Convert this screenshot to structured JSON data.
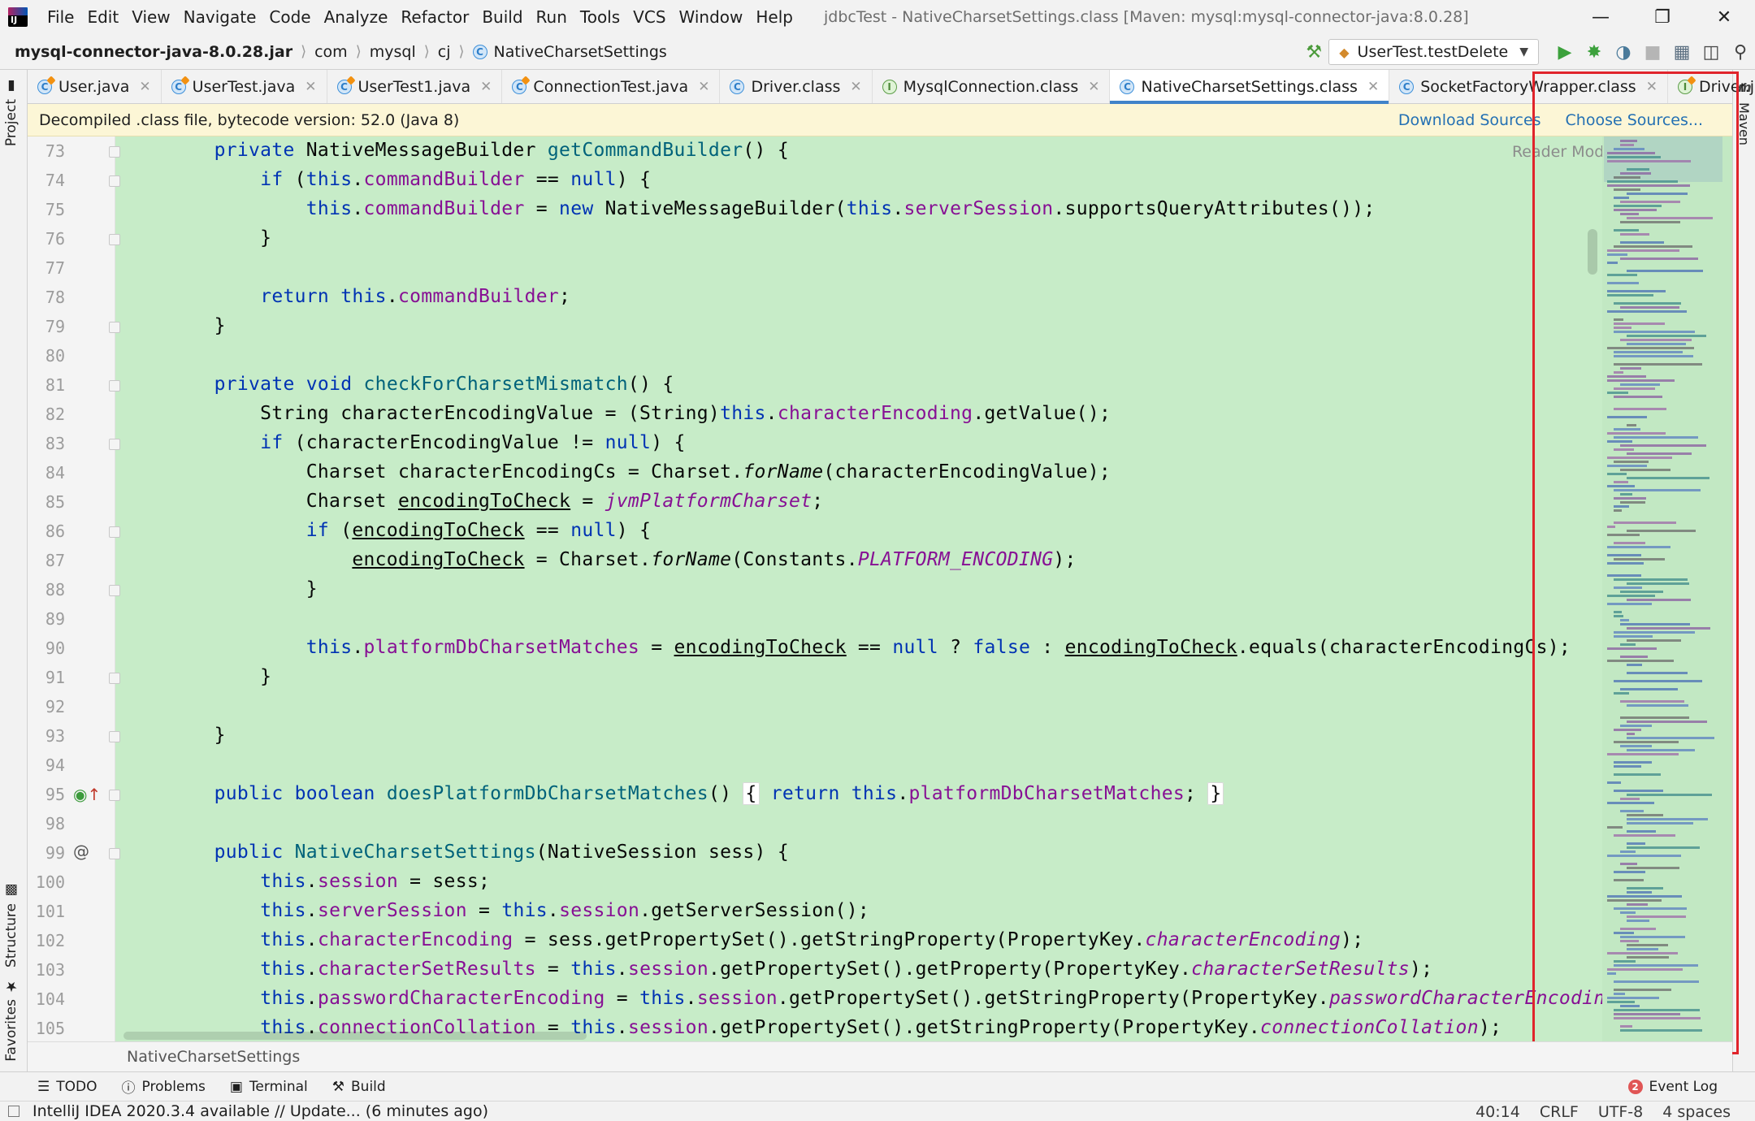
{
  "app": {
    "title": "jdbcTest - NativeCharsetSettings.class [Maven: mysql:mysql-connector-java:8.0.28]",
    "menu": [
      "File",
      "Edit",
      "View",
      "Navigate",
      "Code",
      "Analyze",
      "Refactor",
      "Build",
      "Run",
      "Tools",
      "VCS",
      "Window",
      "Help"
    ]
  },
  "nav": {
    "crumbs": [
      "mysql-connector-java-8.0.28.jar",
      "com",
      "mysql",
      "cj",
      "NativeCharsetSettings"
    ],
    "run_config": "UserTest.testDelete"
  },
  "tabs": [
    {
      "label": "User.java",
      "icon": "class-java"
    },
    {
      "label": "UserTest.java",
      "icon": "class-java"
    },
    {
      "label": "UserTest1.java",
      "icon": "class-java"
    },
    {
      "label": "ConnectionTest.java",
      "icon": "class-java"
    },
    {
      "label": "Driver.class",
      "icon": "class"
    },
    {
      "label": "MysqlConnection.class",
      "icon": "interface"
    },
    {
      "label": "NativeCharsetSettings.class",
      "icon": "class",
      "active": true
    },
    {
      "label": "SocketFactoryWrapper.class",
      "icon": "class"
    },
    {
      "label": "Driver.java",
      "icon": "interface-java"
    }
  ],
  "banner": {
    "text": "Decompiled .class file, bytecode version: 52.0 (Java 8)",
    "download": "Download Sources",
    "choose": "Choose Sources..."
  },
  "editor": {
    "reader_mode": "Reader Mode",
    "line_numbers": [
      "73",
      "74",
      "75",
      "76",
      "77",
      "78",
      "79",
      "80",
      "81",
      "82",
      "83",
      "84",
      "85",
      "86",
      "87",
      "88",
      "89",
      "90",
      "91",
      "92",
      "93",
      "94",
      "95",
      "98",
      "99",
      "100",
      "101",
      "102",
      "103",
      "104",
      "105"
    ],
    "breadcrumb": "NativeCharsetSettings"
  },
  "side": {
    "project": "Project",
    "structure": "Structure",
    "favorites": "Favorites",
    "maven": "Maven"
  },
  "tool_windows": [
    "TODO",
    "Problems",
    "Terminal",
    "Build"
  ],
  "event_log": {
    "label": "Event Log",
    "count": "2"
  },
  "status": {
    "message": "IntelliJ IDEA 2020.3.4 available // Update... (6 minutes ago)",
    "position": "40:14",
    "line_sep": "CRLF",
    "encoding": "UTF-8",
    "indent": "4 spaces"
  },
  "colors": {
    "editor_bg": "#c7ecc8",
    "keyword": "#0033b3",
    "field": "#871094",
    "method": "#00627a",
    "highlight_box": "#e0242b"
  }
}
